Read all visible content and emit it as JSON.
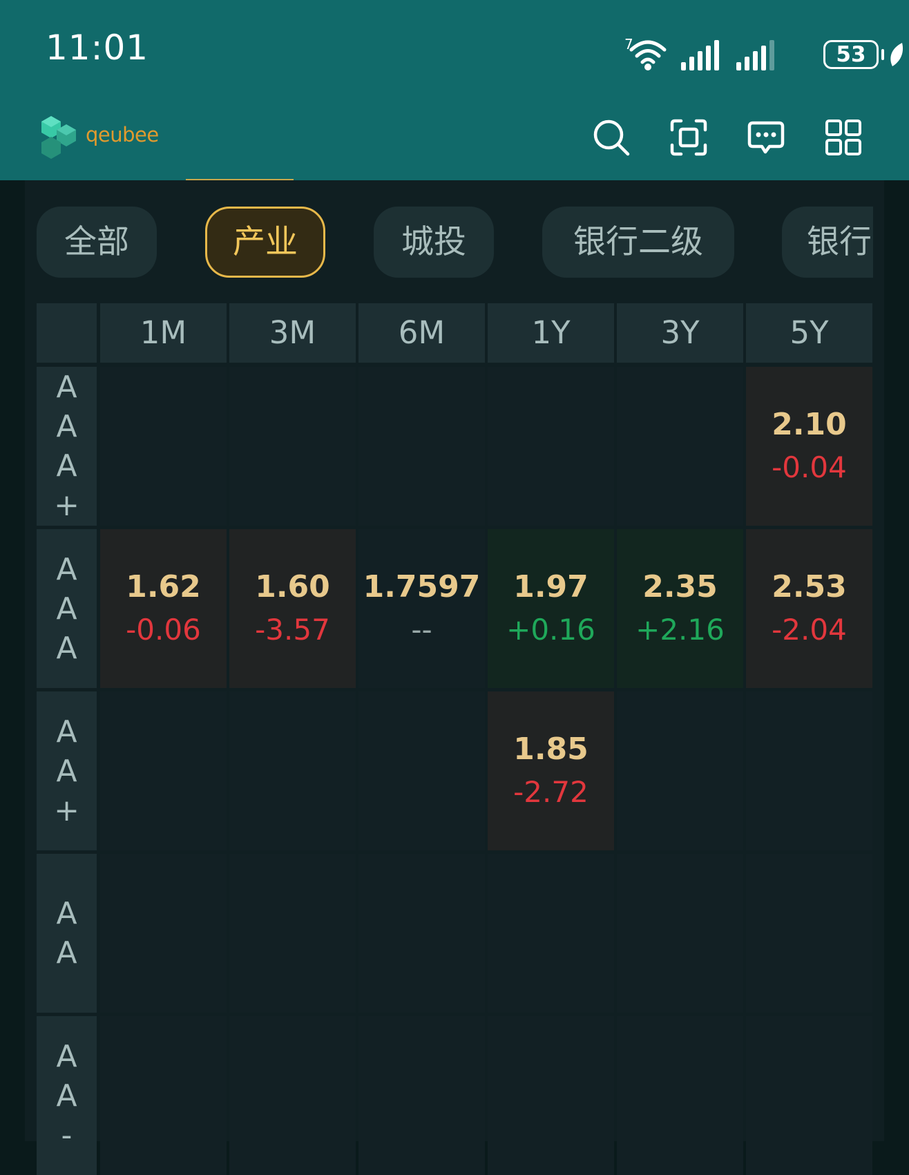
{
  "status_bar": {
    "time": "11:01",
    "wifi_superscript": "7",
    "battery": "53"
  },
  "app_bar": {
    "logo_text": "qeubee",
    "icons": [
      "search-icon",
      "scan-icon",
      "message-icon",
      "grid-icon"
    ]
  },
  "filter_chips": [
    {
      "label": "全部",
      "active": false
    },
    {
      "label": "产业",
      "active": true
    },
    {
      "label": "城投",
      "active": false
    },
    {
      "label": "银行二级",
      "active": false
    },
    {
      "label": "银行",
      "active": false
    }
  ],
  "matrix": {
    "columns": [
      "1M",
      "3M",
      "6M",
      "1Y",
      "3Y",
      "5Y"
    ],
    "rows": [
      {
        "label": "AAA+",
        "cells": [
          null,
          null,
          null,
          null,
          null,
          {
            "value": "2.10",
            "change": "-0.04",
            "trend": "down"
          }
        ]
      },
      {
        "label": "AAA",
        "cells": [
          {
            "value": "1.62",
            "change": "-0.06",
            "trend": "down"
          },
          {
            "value": "1.60",
            "change": "-3.57",
            "trend": "down"
          },
          {
            "value": "1.7597",
            "change": "--",
            "trend": "flat"
          },
          {
            "value": "1.97",
            "change": "+0.16",
            "trend": "up"
          },
          {
            "value": "2.35",
            "change": "+2.16",
            "trend": "up"
          },
          {
            "value": "2.53",
            "change": "-2.04",
            "trend": "down"
          }
        ]
      },
      {
        "label": "AA+",
        "cells": [
          null,
          null,
          null,
          {
            "value": "1.85",
            "change": "-2.72",
            "trend": "down"
          },
          null,
          null
        ]
      },
      {
        "label": "AA",
        "cells": [
          null,
          null,
          null,
          null,
          null,
          null
        ]
      },
      {
        "label": "AA-",
        "cells": [
          null,
          null,
          null,
          null,
          null,
          null
        ]
      }
    ]
  },
  "colors": {
    "header_bg": "#116a6a",
    "accent_gold": "#e7b84a",
    "negative_red": "#e2373d",
    "positive_green": "#1fa85a"
  }
}
